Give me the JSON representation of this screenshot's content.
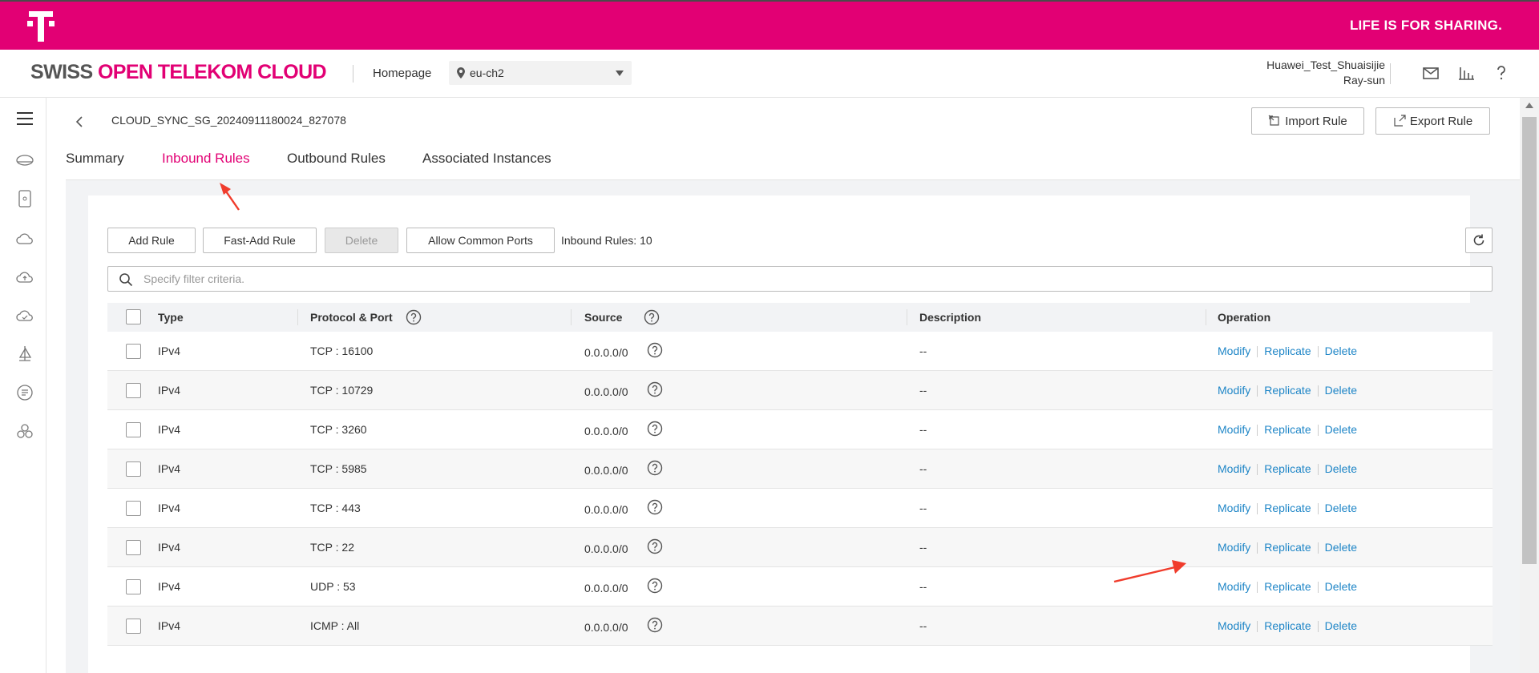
{
  "topbar": {
    "slogan": "LIFE IS FOR SHARING."
  },
  "header": {
    "brand_part1": "SWISS",
    "brand_part2": "OPEN TELEKOM CLOUD",
    "homepage": "Homepage",
    "region": "eu-ch2",
    "account_name": "Huawei_Test_Shuaisijie",
    "user_name": "Ray-sun"
  },
  "page": {
    "sg_name": "CLOUD_SYNC_SG_20240911180024_827078",
    "import_label": "Import Rule",
    "export_label": "Export Rule",
    "tabs": [
      {
        "label": "Summary",
        "active": false
      },
      {
        "label": "Inbound Rules",
        "active": true
      },
      {
        "label": "Outbound Rules",
        "active": false
      },
      {
        "label": "Associated Instances",
        "active": false
      }
    ]
  },
  "toolbar": {
    "add_rule": "Add Rule",
    "fast_add_rule": "Fast-Add Rule",
    "delete": "Delete",
    "allow_common_ports": "Allow Common Ports",
    "rule_count": "Inbound Rules: 10",
    "filter_placeholder": "Specify filter criteria."
  },
  "table": {
    "columns": {
      "type": "Type",
      "protocol_port": "Protocol & Port",
      "source": "Source",
      "description": "Description",
      "operation": "Operation"
    },
    "op_labels": {
      "modify": "Modify",
      "replicate": "Replicate",
      "delete": "Delete"
    },
    "rows": [
      {
        "type": "IPv4",
        "protocol_port": "TCP : 16100",
        "source": "0.0.0.0/0",
        "description": "--"
      },
      {
        "type": "IPv4",
        "protocol_port": "TCP : 10729",
        "source": "0.0.0.0/0",
        "description": "--"
      },
      {
        "type": "IPv4",
        "protocol_port": "TCP : 3260",
        "source": "0.0.0.0/0",
        "description": "--"
      },
      {
        "type": "IPv4",
        "protocol_port": "TCP : 5985",
        "source": "0.0.0.0/0",
        "description": "--"
      },
      {
        "type": "IPv4",
        "protocol_port": "TCP : 443",
        "source": "0.0.0.0/0",
        "description": "--"
      },
      {
        "type": "IPv4",
        "protocol_port": "TCP : 22",
        "source": "0.0.0.0/0",
        "description": "--"
      },
      {
        "type": "IPv4",
        "protocol_port": "UDP : 53",
        "source": "0.0.0.0/0",
        "description": "--"
      },
      {
        "type": "IPv4",
        "protocol_port": "ICMP : All",
        "source": "0.0.0.0/0",
        "description": "--"
      }
    ]
  },
  "colors": {
    "brand": "#e20074",
    "link": "#1f86c7",
    "annotation_arrow": "#f03c2c"
  }
}
